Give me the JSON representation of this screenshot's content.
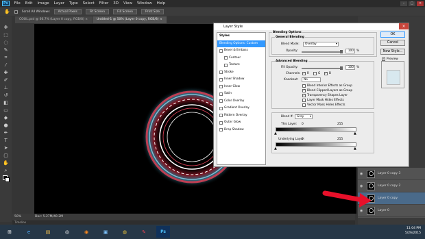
{
  "app": {
    "logo": "Ps"
  },
  "menu": [
    "File",
    "Edit",
    "Image",
    "Layer",
    "Type",
    "Select",
    "Filter",
    "3D",
    "View",
    "Window",
    "Help"
  ],
  "options_bar": {
    "scroll_all": "Scroll All Windows",
    "actual_pixels": "Actual Pixels",
    "fit_screen": "Fit Screen",
    "fill_screen": "Fill Screen",
    "print_size": "Print Size"
  },
  "doc_tabs": [
    {
      "label": "COOL.psd @ 66.7% (Layer 0 copy, RGB/8) ×"
    },
    {
      "label": "Untitled-1 @ 50% (Layer 0 copy, RGB/8) ×"
    }
  ],
  "status": {
    "zoom": "50%",
    "doc": "Doc: 5.27M/40.2M"
  },
  "timeline_label": "Timeline",
  "dialog": {
    "title": "Layer Style",
    "styles_header": "Styles",
    "styles": [
      {
        "label": "Blending Options: Custom",
        "checkbox": false,
        "selected": true
      },
      {
        "label": "Bevel & Emboss",
        "checkbox": true
      },
      {
        "label": "Contour",
        "checkbox": true,
        "indent": true
      },
      {
        "label": "Texture",
        "checkbox": true,
        "indent": true
      },
      {
        "label": "Stroke",
        "checkbox": true
      },
      {
        "label": "Inner Shadow",
        "checkbox": true
      },
      {
        "label": "Inner Glow",
        "checkbox": true
      },
      {
        "label": "Satin",
        "checkbox": true
      },
      {
        "label": "Color Overlay",
        "checkbox": true
      },
      {
        "label": "Gradient Overlay",
        "checkbox": true
      },
      {
        "label": "Pattern Overlay",
        "checkbox": true
      },
      {
        "label": "Outer Glow",
        "checkbox": true
      },
      {
        "label": "Drop Shadow",
        "checkbox": true
      }
    ],
    "blending_options": "Blending Options",
    "general_blending": "General Blending",
    "blend_mode_label": "Blend Mode:",
    "blend_mode_value": "Overlay",
    "opacity_label": "Opacity:",
    "opacity_value": "100",
    "opacity_fraction": 1.0,
    "percent": "%",
    "advanced_blending": "Advanced Blending",
    "fill_opacity_label": "Fill Opacity:",
    "fill_opacity_value": "100",
    "fill_opacity_fraction": 1.0,
    "channels_label": "Channels:",
    "channel_r": "R",
    "channel_g": "G",
    "channel_b": "B",
    "knockout_label": "Knockout:",
    "knockout_value": "No",
    "opt1": "Blend Interior Effects as Group",
    "opt2": "Blend Clipped Layers as Group",
    "opt3": "Transparency Shapes Layer",
    "opt4": "Layer Mask Hides Effects",
    "opt5": "Vector Mask Hides Effects",
    "blend_if_label": "Blend If:",
    "blend_if_value": "Gray",
    "this_layer_label": "This Layer:",
    "this_layer_min": "0",
    "this_layer_max": "255",
    "underlying_label": "Underlying Layer:",
    "underlying_min": "0",
    "underlying_max": "255",
    "ok": "OK",
    "cancel": "Cancel",
    "new_style": "New Style...",
    "preview_label": "Preview"
  },
  "layers": [
    {
      "name": "Layer 0 copy 3",
      "selected": false
    },
    {
      "name": "Layer 0 copy 2",
      "selected": false
    },
    {
      "name": "Layer 0 copy",
      "selected": true
    },
    {
      "name": "Layer 0",
      "selected": false
    }
  ],
  "taskbar": {
    "apps": [
      "start-button",
      "ie-icon",
      "file-explorer-icon",
      "steam-icon",
      "firefox-icon",
      "photo-viewer-icon",
      "chrome-icon",
      "paint-icon",
      "photoshop-icon"
    ],
    "time": "11:04 PM",
    "date": "5/26/2015"
  },
  "colors": {
    "accent": "#3399ff",
    "annotation_arrow": "#e8102a",
    "taskbar": "#263747"
  }
}
